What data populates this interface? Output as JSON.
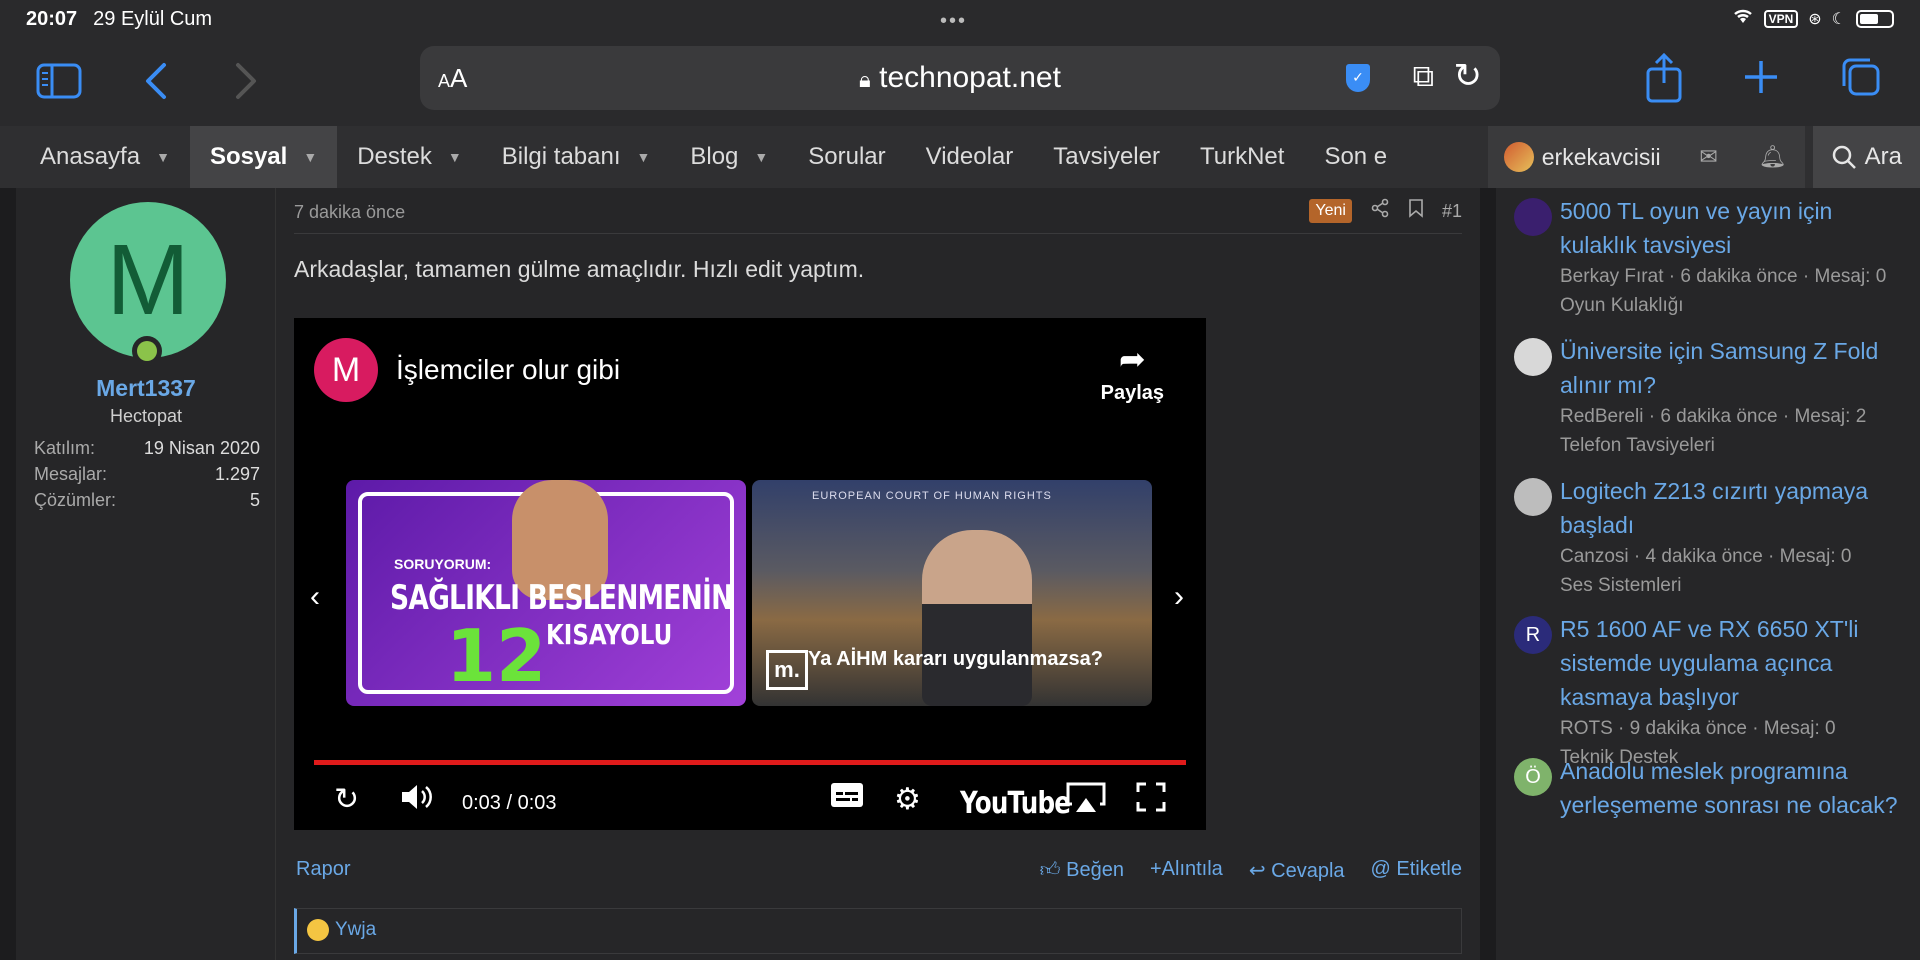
{
  "status": {
    "time": "20:07",
    "date": "29 Eylül Cum",
    "vpn": "VPN"
  },
  "browser": {
    "url": "technopat.net",
    "reader_label": "AA"
  },
  "nav": {
    "items": [
      {
        "label": "Anasayfa",
        "has_menu": true
      },
      {
        "label": "Sosyal",
        "has_menu": true,
        "active": true
      },
      {
        "label": "Destek",
        "has_menu": true
      },
      {
        "label": "Bilgi tabanı",
        "has_menu": true
      },
      {
        "label": "Blog",
        "has_menu": true
      },
      {
        "label": "Sorular",
        "has_menu": false
      },
      {
        "label": "Videolar",
        "has_menu": false
      },
      {
        "label": "Tavsiyeler",
        "has_menu": false
      },
      {
        "label": "TurkNet",
        "has_menu": false
      },
      {
        "label": "Son e",
        "has_menu": false
      }
    ],
    "username": "erkekavcisii",
    "search_label": "Ara"
  },
  "post": {
    "author": {
      "initial": "M",
      "name": "Mert1337",
      "title": "Hectopat",
      "stats": [
        {
          "key": "Katılım:",
          "value": "19 Nisan 2020"
        },
        {
          "key": "Mesajlar:",
          "value": "1.297"
        },
        {
          "key": "Çözümler:",
          "value": "5"
        }
      ]
    },
    "time": "7 dakika önce",
    "new_badge": "Yeni",
    "number": "#1",
    "text": "Arkadaşlar, tamamen gülme amaçlıdır. Hızlı edit yaptım.",
    "video": {
      "channel_initial": "M",
      "title": "İşlemciler olur gibi",
      "share_label": "Paylaş",
      "time_display": "0:03 / 0:03",
      "progress": 1.0,
      "brand": "YouTube",
      "thumb1": {
        "sub": "SORUYORUM:",
        "line1": "SAĞLIKLI BESLENMENİN",
        "number": "12",
        "line2": "KISAYOLU"
      },
      "thumb2": {
        "banner": "EUROPEAN COURT OF HUMAN RIGHTS",
        "logo": "m.",
        "caption": "Ya AİHM kararı uygulanmazsa?"
      }
    },
    "actions": {
      "report": "Rapor",
      "like": "Beğen",
      "quote": "Alıntıla",
      "reply": "Cevapla",
      "mention": "Etiketle"
    },
    "reaction_user": "Ywja"
  },
  "sidebar": {
    "threads": [
      {
        "title": "5000 TL oyun ve yayın için kulaklık tavsiyesi",
        "meta": "Berkay Fırat · 6 dakika önce · Mesaj: 0",
        "forum": "Oyun Kulaklığı",
        "avatar_color": "#3a1f6e",
        "avatar_text": ""
      },
      {
        "title": "Üniversite için Samsung Z Fold alınır mı?",
        "meta": "RedBereli · 6 dakika önce · Mesaj: 2",
        "forum": "Telefon Tavsiyeleri",
        "avatar_color": "#d8d8d8",
        "avatar_text": ""
      },
      {
        "title": "Logitech Z213 cızırtı yapmaya başladı",
        "meta": "Canzosi · 4 dakika önce · Mesaj: 0",
        "forum": "Ses Sistemleri",
        "avatar_color": "#bdbdbd",
        "avatar_text": ""
      },
      {
        "title": "R5 1600 AF ve RX 6650 XT'li sistemde uygulama açınca kasmaya başlıyor",
        "meta": "ROTS · 9 dakika önce · Mesaj: 0",
        "forum": "Teknik Destek",
        "avatar_color": "#2b2b7a",
        "avatar_text": "R"
      },
      {
        "title": "Anadolu meslek programına yerleşememe sonrası ne olacak?",
        "meta": "",
        "forum": "",
        "avatar_color": "#7fb36b",
        "avatar_text": "Ö"
      }
    ]
  }
}
